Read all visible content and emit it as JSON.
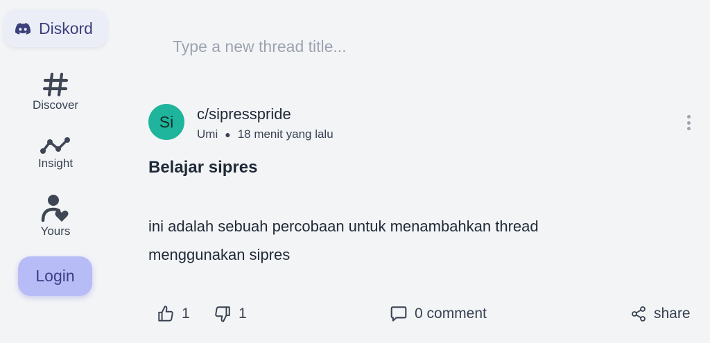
{
  "brand": {
    "label": "Diskord",
    "icon": "discord-icon"
  },
  "nav": [
    {
      "label": "Discover",
      "icon": "hash-icon"
    },
    {
      "label": "Insight",
      "icon": "trend-icon"
    },
    {
      "label": "Yours",
      "icon": "user-heart-icon"
    }
  ],
  "login_label": "Login",
  "new_thread": {
    "placeholder": "Type a new thread title...",
    "value": ""
  },
  "post": {
    "avatar_initials": "Si",
    "community": "c/sipresspride",
    "author": "Umi",
    "time": "18 menit yang lalu",
    "title": "Belajar sipres",
    "body": "ini adalah sebuah percobaan untuk menambahkan thread menggunakan sipres",
    "likes": "1",
    "dislikes": "1",
    "comments": "0 comment",
    "share_label": "share"
  },
  "colors": {
    "background": "#f3f4f6",
    "avatar": "#1fb59c",
    "login_button": "#b7bcf6",
    "brand_text": "#3b3f7a"
  }
}
